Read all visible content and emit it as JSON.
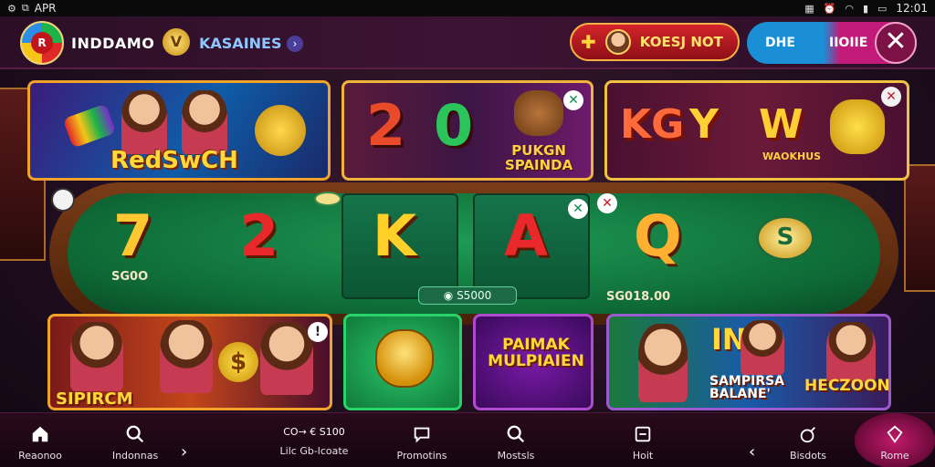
{
  "statusbar": {
    "left_label": "APR",
    "time": "12:01"
  },
  "header": {
    "brand": "INDDAMO",
    "subbrand": "KASAINES",
    "badge_letter": "V",
    "bonus_label": "KOESJ NOT",
    "auth_primary": "DHE",
    "auth_secondary": "IIOIIE"
  },
  "banners": [
    {
      "title": "RedSwCH"
    },
    {
      "big_left": "2",
      "big_right": "0",
      "sub_line1": "PUKGN",
      "sub_line2": "SPAINDA"
    },
    {
      "letters": [
        "KG",
        "Y",
        "W"
      ],
      "sub": "WAOKHUS"
    }
  ],
  "table": {
    "symbols": [
      {
        "char": "7",
        "amount": "SG0O"
      },
      {
        "char": "2",
        "amount": ""
      },
      {
        "char": "K",
        "amount": ""
      },
      {
        "char": "A",
        "amount": ""
      },
      {
        "char": "Q",
        "amount": "SG018.00"
      }
    ],
    "pot": "S5000",
    "chip_label": "S"
  },
  "tiles": [
    {
      "title": "SIPIRCM"
    },
    {
      "title": ""
    },
    {
      "title_line1": "PAIMAK",
      "title_line2": "MULPIAIEN"
    },
    {
      "title_line1": "INO",
      "title_line2": "SAMPIRSA",
      "title_line3": "BALANE'",
      "title_line4": "HECZOON"
    }
  ],
  "nav": {
    "items": [
      {
        "label": "Reaonoo",
        "icon": "home-icon"
      },
      {
        "label": "Indonnas",
        "icon": "search-icon"
      },
      {
        "label": "Lilc Gb-lcoate",
        "icon": "wallet-icon",
        "extra": "CO→ € S100"
      },
      {
        "label": "Promotins",
        "icon": "chat-icon"
      },
      {
        "label": "Mostsls",
        "icon": "search-icon"
      },
      {
        "label": "Hoit",
        "icon": "card-icon"
      },
      {
        "label": "Bisdots",
        "icon": "bomb-icon"
      },
      {
        "label": "Rome",
        "icon": "diamond-icon"
      }
    ]
  }
}
